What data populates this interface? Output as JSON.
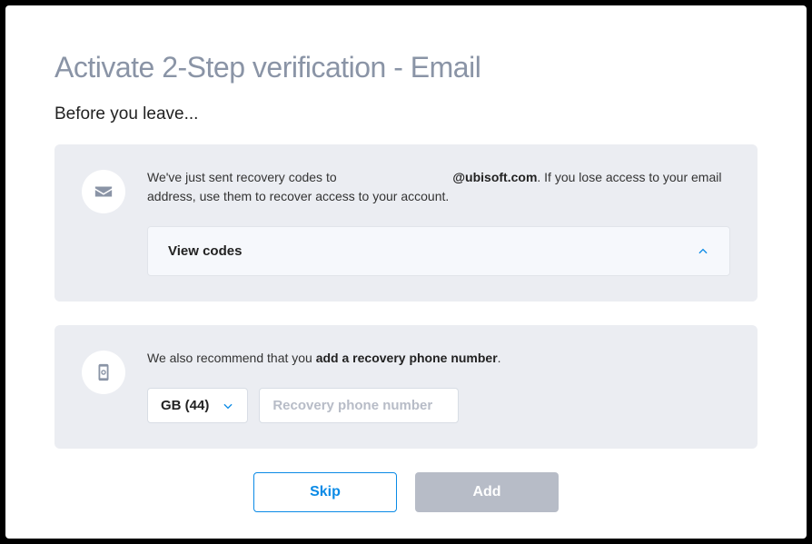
{
  "title": "Activate 2-Step verification - Email",
  "subtitle": "Before you leave...",
  "recovery_codes": {
    "text_pre": "We've just sent recovery codes to ",
    "email_domain": "@ubisoft.com",
    "text_post": ". If you lose access to your email address, use them to recover access to your account.",
    "view_codes_label": "View codes"
  },
  "recovery_phone": {
    "text_pre": "We also recommend that you ",
    "bold_text": "add a recovery phone number",
    "text_post": ".",
    "country_code_label": "GB (44)",
    "phone_placeholder": "Recovery phone number"
  },
  "footer": {
    "skip_label": "Skip",
    "add_label": "Add"
  }
}
